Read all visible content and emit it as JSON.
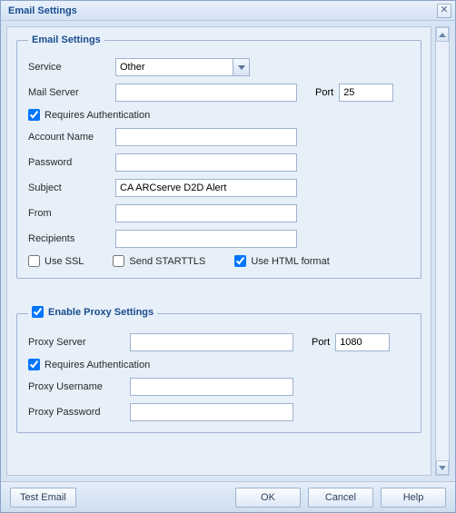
{
  "title": "Email Settings",
  "emailGroup": {
    "legend": "Email Settings",
    "serviceLabel": "Service",
    "serviceValue": "Other",
    "mailServerLabel": "Mail Server",
    "mailServerValue": "",
    "portLabel": "Port",
    "portValue": "25",
    "requiresAuthLabel": "Requires Authentication",
    "accountNameLabel": "Account Name",
    "accountNameValue": "",
    "passwordLabel": "Password",
    "passwordValue": "",
    "subjectLabel": "Subject",
    "subjectValue": "CA ARCserve D2D Alert",
    "fromLabel": "From",
    "fromValue": "",
    "recipientsLabel": "Recipients",
    "recipientsValue": "",
    "useSSLLabel": "Use SSL",
    "sendStarttlsLabel": "Send STARTTLS",
    "useHtmlLabel": "Use HTML format"
  },
  "proxyGroup": {
    "enableLabel": "Enable Proxy Settings",
    "proxyServerLabel": "Proxy Server",
    "proxyServerValue": "",
    "portLabel": "Port",
    "portValue": "1080",
    "requiresAuthLabel": "Requires Authentication",
    "proxyUserLabel": "Proxy Username",
    "proxyUserValue": "",
    "proxyPasswordLabel": "Proxy Password",
    "proxyPasswordValue": ""
  },
  "buttons": {
    "testEmail": "Test Email",
    "ok": "OK",
    "cancel": "Cancel",
    "help": "Help"
  }
}
